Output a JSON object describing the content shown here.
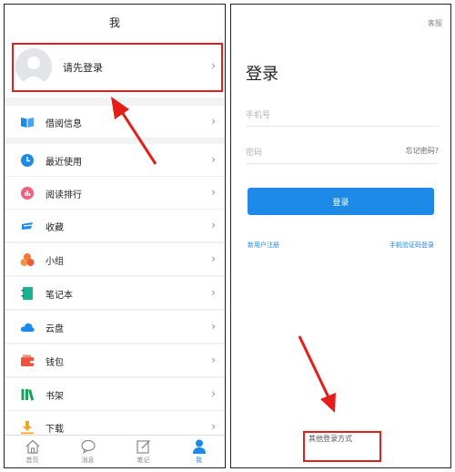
{
  "left": {
    "title": "我",
    "profile_prompt": "请先登录",
    "menu": [
      {
        "label": "借阅信息",
        "icon": "book-icon"
      },
      {
        "label": "最近使用",
        "icon": "clock-icon"
      },
      {
        "label": "阅读排行",
        "icon": "ranking-icon"
      },
      {
        "label": "收藏",
        "icon": "favorites-icon"
      },
      {
        "label": "小组",
        "icon": "group-icon"
      },
      {
        "label": "笔记本",
        "icon": "notebook-icon"
      },
      {
        "label": "云盘",
        "icon": "cloud-icon"
      },
      {
        "label": "钱包",
        "icon": "wallet-icon"
      },
      {
        "label": "书架",
        "icon": "bookshelf-icon"
      },
      {
        "label": "下载",
        "icon": "download-icon"
      }
    ],
    "tabs": [
      {
        "label": "首页",
        "icon": "home-icon"
      },
      {
        "label": "消息",
        "icon": "message-icon"
      },
      {
        "label": "笔记",
        "icon": "note-icon"
      },
      {
        "label": "我",
        "icon": "person-icon",
        "active": true
      }
    ]
  },
  "right": {
    "service": "客服",
    "title": "登录",
    "phone_placeholder": "手机号",
    "password_placeholder": "密码",
    "forgot": "忘记密码?",
    "login_button": "登录",
    "register": "新用户注册",
    "sms_login": "手机验证码登录",
    "other_login": "其他登录方式"
  },
  "colors": {
    "accent": "#1e8ae8",
    "highlight": "#e41f19"
  }
}
